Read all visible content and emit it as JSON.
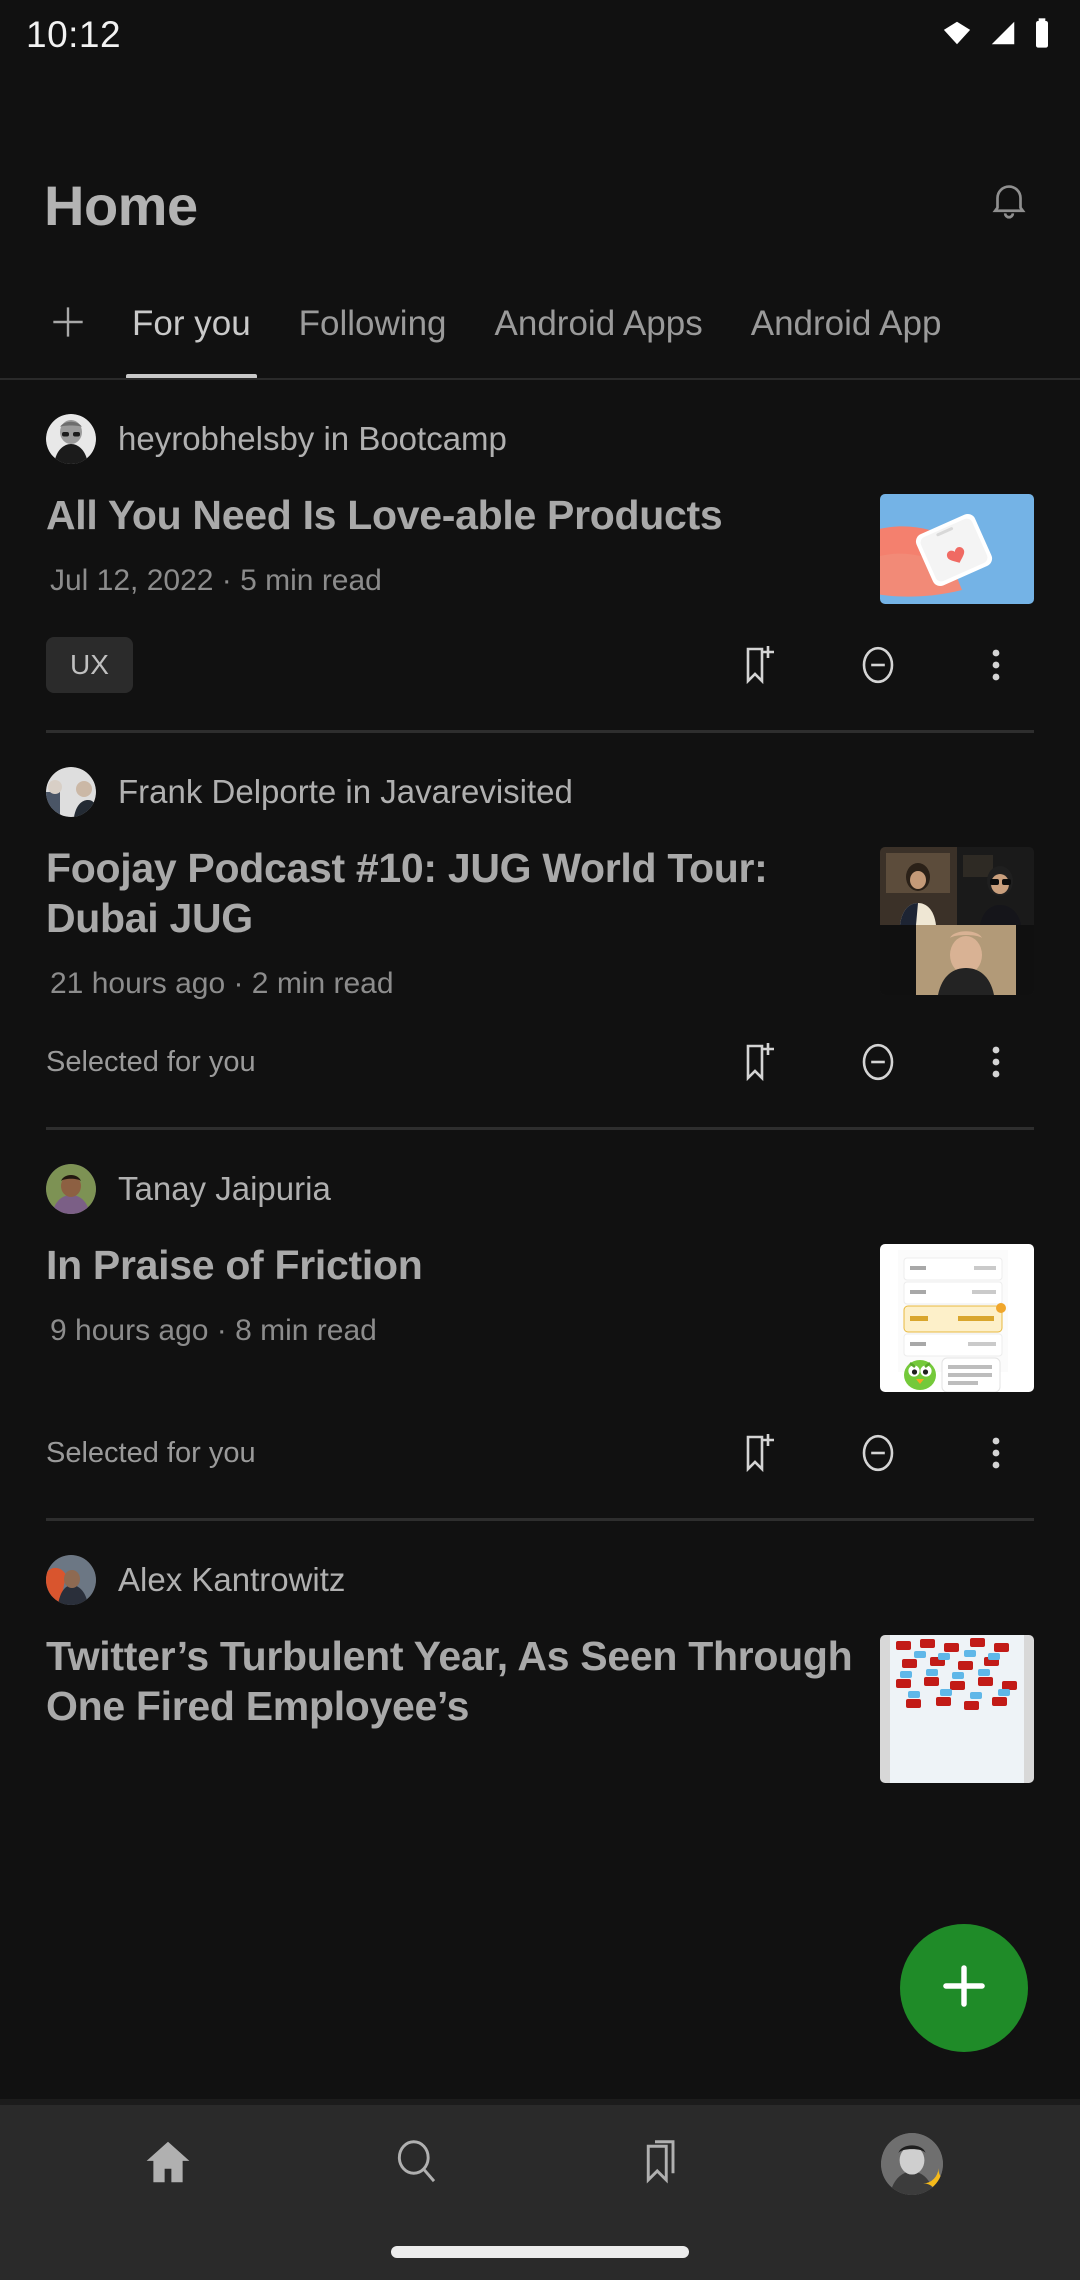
{
  "status_bar": {
    "time": "10:12",
    "icons": [
      "wifi-icon",
      "cell-signal-icon",
      "battery-icon"
    ]
  },
  "header": {
    "title": "Home",
    "notification_icon": "bell-icon"
  },
  "tabs": {
    "add_icon": "plus-icon",
    "items": [
      {
        "label": "For you",
        "active": true
      },
      {
        "label": "Following",
        "active": false
      },
      {
        "label": "Android Apps",
        "active": false
      },
      {
        "label": "Android App",
        "active": false
      }
    ]
  },
  "feed": {
    "cards": [
      {
        "author": "heyrobhelsby in Bootcamp",
        "title": "All You Need Is Love-able Products",
        "meta": "Jul 12, 2022  ·  5 min read",
        "footer_label": "UX",
        "footer_type": "tag",
        "thumbnail": "hands-holding-phone-with-heart",
        "actions": [
          "bookmark-add-icon",
          "minus-circle-icon",
          "more-options-icon"
        ]
      },
      {
        "author": "Frank Delporte in Javarevisited",
        "title": "Foojay Podcast #10: JUG World Tour: Dubai JUG",
        "meta": "21 hours ago  ·  2 min read",
        "footer_label": "Selected for you",
        "footer_type": "label",
        "thumbnail": "video-call-grid-three-people",
        "actions": [
          "bookmark-add-icon",
          "minus-circle-icon",
          "more-options-icon"
        ]
      },
      {
        "author": "Tanay Jaipuria",
        "title": "In Praise of Friction",
        "meta": "9 hours ago  ·  8 min read",
        "footer_label": "Selected for you",
        "footer_type": "label",
        "thumbnail": "duolingo-app-screenshot-owl",
        "actions": [
          "bookmark-add-icon",
          "minus-circle-icon",
          "more-options-icon"
        ]
      },
      {
        "author": "Alex Kantrowitz",
        "title": "Twitter’s Turbulent Year, As Seen Through One Fired Employee’s",
        "meta": "",
        "footer_label": "",
        "footer_type": "none",
        "thumbnail": "red-blue-abstract-pattern",
        "actions": []
      }
    ]
  },
  "fab": {
    "icon": "plus-icon",
    "color": "#1f8b28"
  },
  "bottom_nav": {
    "items": [
      {
        "name": "home",
        "icon": "home-icon",
        "active": true
      },
      {
        "name": "search",
        "icon": "search-icon",
        "active": false
      },
      {
        "name": "library",
        "icon": "bookmarks-icon",
        "active": false
      },
      {
        "name": "profile",
        "icon": "profile-avatar-icon",
        "active": false,
        "badge": "star-badge"
      }
    ]
  },
  "colors": {
    "background": "#111111",
    "surface": "#0d0d0d",
    "nav_background": "#2a2a2a",
    "text_primary": "#b3b3b3",
    "text_secondary": "#8c8c8c",
    "accent_green": "#1f8b28",
    "badge_yellow": "#f5ba1a",
    "divider": "#2e2e2e"
  }
}
